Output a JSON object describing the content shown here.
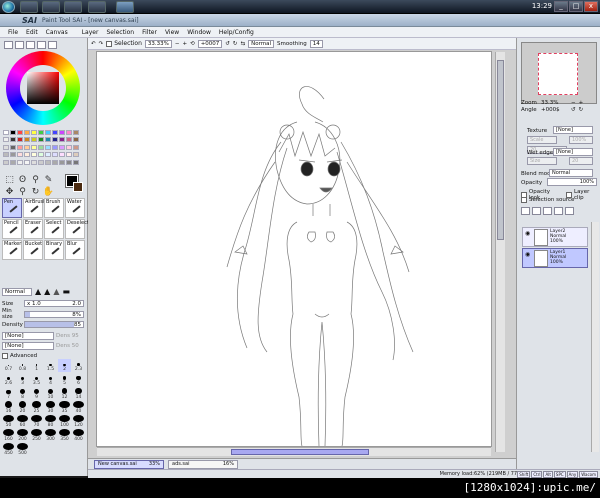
{
  "taskbar": {
    "clock": "13:29",
    "win_controls": [
      "_",
      "□",
      "x"
    ]
  },
  "title": {
    "app": "SAI",
    "document": "Paint Tool SAI - [new canvas.sai]"
  },
  "menu": [
    "File",
    "Edit",
    "Canvas",
    "Layer",
    "Selection",
    "Filter",
    "View",
    "Window",
    "Help/Config"
  ],
  "toolbar": {
    "selection_label": "Selection",
    "zoom": "33.33%",
    "angle": "+0007",
    "mode": "Normal",
    "smoothing_label": "Smoothing",
    "smoothing": "14"
  },
  "brushes": [
    {
      "label": "Pen",
      "selected": true
    },
    {
      "label": "AirBrush"
    },
    {
      "label": "Brush"
    },
    {
      "label": "Water"
    },
    {
      "label": "Pencil"
    },
    {
      "label": "Eraser"
    },
    {
      "label": "Select"
    },
    {
      "label": "Deselect"
    },
    {
      "label": "Marker"
    },
    {
      "label": "Bucket"
    },
    {
      "label": "Binary"
    },
    {
      "label": "Blur"
    }
  ],
  "brush_settings": {
    "mode": "Normal",
    "size_label": "Size",
    "size_mult": "x 1.0",
    "size_value": "2.0",
    "minsize_label": "Min size",
    "minsize_value": "8%",
    "density_label": "Density",
    "density_value": "85",
    "texture": "[None]",
    "texture_strength": "Dens 95",
    "blending": "[None]",
    "blending_strength": "Dens 50",
    "advanced_label": "Advanced"
  },
  "size_presets": [
    "0.7",
    "0.8",
    "1",
    "1.5",
    "2",
    "2.3",
    "2.6",
    "3",
    "3.5",
    "4",
    "5",
    "6",
    "7",
    "8",
    "9",
    "10",
    "12",
    "14",
    "16",
    "20",
    "25",
    "30",
    "35",
    "40",
    "50",
    "60",
    "70",
    "80",
    "100",
    "120",
    "160",
    "200",
    "250",
    "300",
    "350",
    "400",
    "450",
    "500"
  ],
  "canvas_tabs": [
    {
      "name": "New canvas.sai",
      "pct": "33%",
      "active": true
    },
    {
      "name": "ads.sai",
      "pct": "16%",
      "active": false
    }
  ],
  "navigator": {
    "zoom_label": "Zoom",
    "zoom": "33.3%",
    "angle_label": "Angle",
    "angle": "+000$"
  },
  "layer_props": {
    "texture_label": "Texture",
    "texture": "[None]",
    "scale": "Scale",
    "scale_val": "100%",
    "strength": "20",
    "wetedge_label": "Wet edge",
    "wetedge": "[None]",
    "size_label": "Size",
    "size_val": "20",
    "blend_label": "Blend mode",
    "blend": "Normal",
    "opacity_label": "Opacity",
    "opacity": "100%",
    "opacity_lock": "Opacity lock",
    "layer_clip": "Layer clip",
    "selection_source": "Selection source"
  },
  "layers": [
    {
      "name": "Layer2",
      "mode": "Normal",
      "opacity": "100%",
      "selected": false
    },
    {
      "name": "Layer1",
      "mode": "Normal",
      "opacity": "100%",
      "selected": true
    }
  ],
  "status": {
    "memory": "Memory load:62% (219MB / 771MB)",
    "indicators": [
      "Shift",
      "Ctrl",
      "Alt",
      "SPC",
      "Any",
      "Wacom"
    ]
  },
  "watermark": "[1280x1024]:upic.me/"
}
